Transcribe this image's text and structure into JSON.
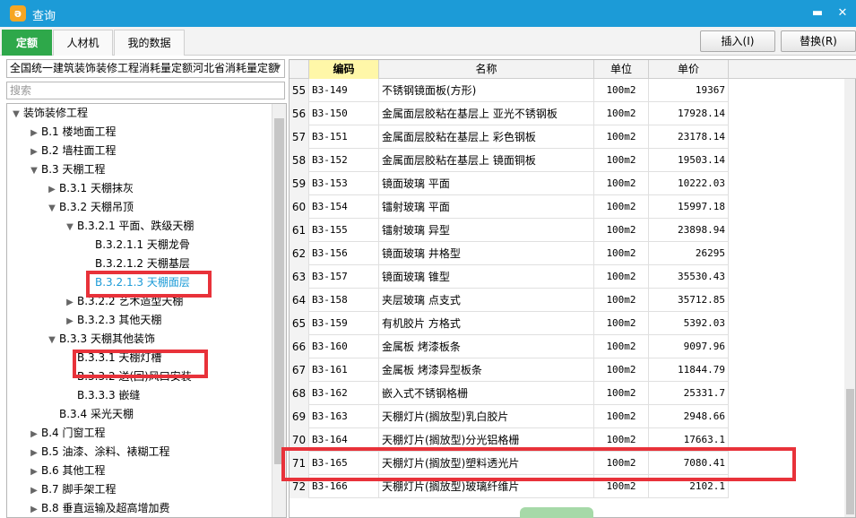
{
  "window": {
    "title": "查询",
    "minimize_icon": "minimize-icon",
    "close_icon": "close-icon"
  },
  "tabs": [
    {
      "label": "定额",
      "active": true
    },
    {
      "label": "人材机",
      "active": false
    },
    {
      "label": "我的数据",
      "active": false
    }
  ],
  "toolbar": {
    "insert_label": "插入(I)",
    "replace_label": "替换(R)"
  },
  "quota_selector": {
    "value": "全国统一建筑装饰装修工程消耗量定额河北省消耗量定额"
  },
  "search": {
    "placeholder": "搜索"
  },
  "tree": [
    {
      "label": "装饰装修工程",
      "toggle": "▼",
      "level": 0
    },
    {
      "label": "B.1 楼地面工程",
      "toggle": "▶",
      "level": 1
    },
    {
      "label": "B.2 墙柱面工程",
      "toggle": "▶",
      "level": 1
    },
    {
      "label": "B.3 天棚工程",
      "toggle": "▼",
      "level": 1
    },
    {
      "label": "B.3.1 天棚抹灰",
      "toggle": "▶",
      "level": 2
    },
    {
      "label": "B.3.2 天棚吊顶",
      "toggle": "▼",
      "level": 2
    },
    {
      "label": "B.3.2.1 平面、跌级天棚",
      "toggle": "▼",
      "level": 3
    },
    {
      "label": "B.3.2.1.1 天棚龙骨",
      "toggle": "",
      "level": 4
    },
    {
      "label": "B.3.2.1.2 天棚基层",
      "toggle": "",
      "level": 4
    },
    {
      "label": "B.3.2.1.3 天棚面层",
      "toggle": "",
      "level": 4,
      "selected": true
    },
    {
      "label": "B.3.2.2 艺术造型天棚",
      "toggle": "▶",
      "level": 3
    },
    {
      "label": "B.3.2.3 其他天棚",
      "toggle": "▶",
      "level": 3
    },
    {
      "label": "B.3.3 天棚其他装饰",
      "toggle": "▼",
      "level": 2
    },
    {
      "label": "B.3.3.1 天棚灯槽",
      "toggle": "",
      "level": 3
    },
    {
      "label": "B.3.3.2 送(回)风口安装",
      "toggle": "",
      "level": 3
    },
    {
      "label": "B.3.3.3 嵌缝",
      "toggle": "",
      "level": 3
    },
    {
      "label": "B.3.4 采光天棚",
      "toggle": "",
      "level": 2
    },
    {
      "label": "B.4 门窗工程",
      "toggle": "▶",
      "level": 1
    },
    {
      "label": "B.5 油漆、涂料、裱糊工程",
      "toggle": "▶",
      "level": 1
    },
    {
      "label": "B.6 其他工程",
      "toggle": "▶",
      "level": 1
    },
    {
      "label": "B.7 脚手架工程",
      "toggle": "▶",
      "level": 1
    },
    {
      "label": "B.8 垂直运输及超高增加费",
      "toggle": "▶",
      "level": 1
    }
  ],
  "table": {
    "headers": {
      "code": "编码",
      "name": "名称",
      "unit": "单位",
      "price": "单价"
    },
    "rows": [
      {
        "num": "55",
        "code": "B3-149",
        "name": "不锈钢镜面板(方形)",
        "unit": "100m2",
        "price": "19367"
      },
      {
        "num": "56",
        "code": "B3-150",
        "name": "金属面层胶粘在基层上 亚光不锈钢板",
        "unit": "100m2",
        "price": "17928.14"
      },
      {
        "num": "57",
        "code": "B3-151",
        "name": "金属面层胶粘在基层上 彩色钢板",
        "unit": "100m2",
        "price": "23178.14"
      },
      {
        "num": "58",
        "code": "B3-152",
        "name": "金属面层胶粘在基层上 镜面铜板",
        "unit": "100m2",
        "price": "19503.14"
      },
      {
        "num": "59",
        "code": "B3-153",
        "name": "镜面玻璃 平面",
        "unit": "100m2",
        "price": "10222.03"
      },
      {
        "num": "60",
        "code": "B3-154",
        "name": "镭射玻璃 平面",
        "unit": "100m2",
        "price": "15997.18"
      },
      {
        "num": "61",
        "code": "B3-155",
        "name": "镭射玻璃 异型",
        "unit": "100m2",
        "price": "23898.94"
      },
      {
        "num": "62",
        "code": "B3-156",
        "name": "镜面玻璃 井格型",
        "unit": "100m2",
        "price": "26295"
      },
      {
        "num": "63",
        "code": "B3-157",
        "name": "镜面玻璃 锥型",
        "unit": "100m2",
        "price": "35530.43"
      },
      {
        "num": "64",
        "code": "B3-158",
        "name": "夹层玻璃 点支式",
        "unit": "100m2",
        "price": "35712.85"
      },
      {
        "num": "65",
        "code": "B3-159",
        "name": "有机胶片 方格式",
        "unit": "100m2",
        "price": "5392.03"
      },
      {
        "num": "66",
        "code": "B3-160",
        "name": "金属板 烤漆板条",
        "unit": "100m2",
        "price": "9097.96"
      },
      {
        "num": "67",
        "code": "B3-161",
        "name": "金属板 烤漆异型板条",
        "unit": "100m2",
        "price": "11844.79"
      },
      {
        "num": "68",
        "code": "B3-162",
        "name": "嵌入式不锈钢格栅",
        "unit": "100m2",
        "price": "25331.7"
      },
      {
        "num": "69",
        "code": "B3-163",
        "name": "天棚灯片(搁放型)乳白胶片",
        "unit": "100m2",
        "price": "2948.66"
      },
      {
        "num": "70",
        "code": "B3-164",
        "name": "天棚灯片(搁放型)分光铝格栅",
        "unit": "100m2",
        "price": "17663.1"
      },
      {
        "num": "71",
        "code": "B3-165",
        "name": "天棚灯片(搁放型)塑料透光片",
        "unit": "100m2",
        "price": "7080.41"
      },
      {
        "num": "72",
        "code": "B3-166",
        "name": "天棚灯片(搁放型)玻璃纤维片",
        "unit": "100m2",
        "price": "2102.1"
      }
    ]
  },
  "colors": {
    "titlebar": "#1c9bd7",
    "active_tab": "#2ea84a",
    "highlight_box": "#e8323a",
    "code_header": "#fff7a8"
  }
}
